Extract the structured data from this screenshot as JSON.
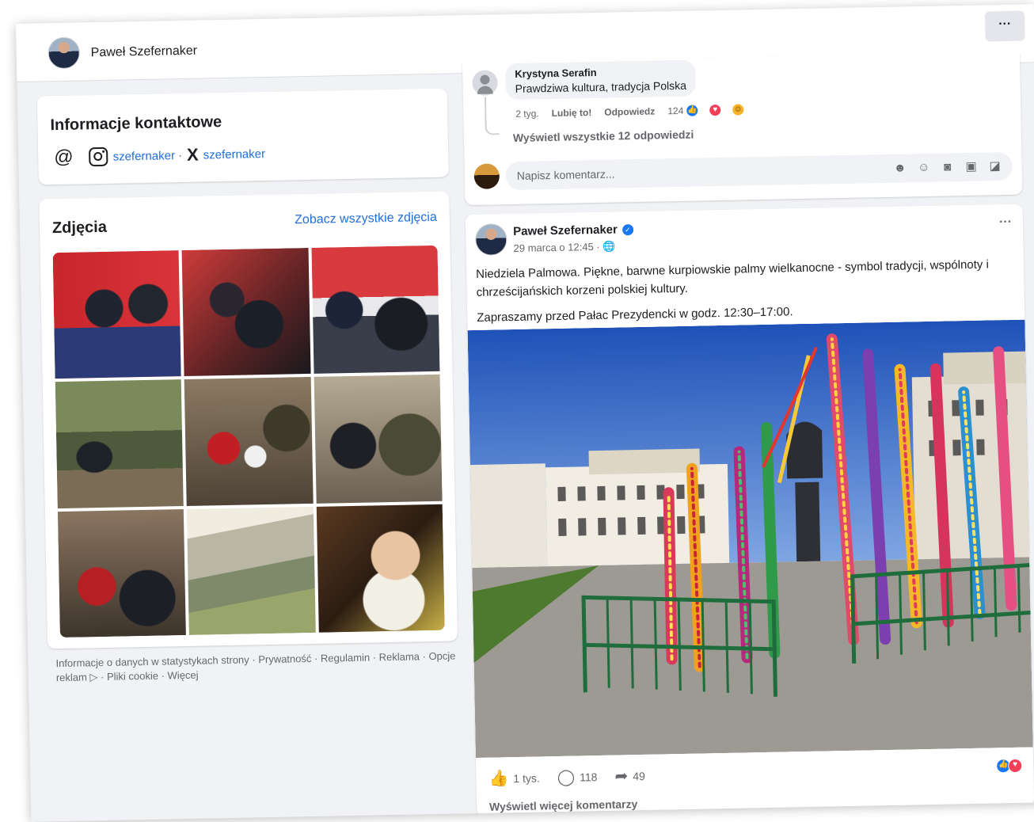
{
  "header": {
    "page_name": "Paweł Szefernaker",
    "more_label": "···"
  },
  "contact": {
    "title": "Informacje kontaktowe",
    "at_symbol": "@",
    "instagram_handle": "szefernaker",
    "separator": "·",
    "x_symbol": "X",
    "x_handle": "szefernaker"
  },
  "photos": {
    "title": "Zdjęcia",
    "see_all": "Zobacz wszystkie zdjęcia"
  },
  "footer": {
    "text": "Informacje o danych w statystykach strony · Prywatność · Regulamin · Reklama · Opcje reklam ▷ · Pliki cookie · Więcej"
  },
  "comment": {
    "author": "Krystyna Serafin",
    "text": "Prawdziwa kultura, tradycja Polska",
    "age": "2 tyg.",
    "like_label": "Lubię to!",
    "reply_label": "Odpowiedz",
    "reaction_count": "124",
    "view_replies": "Wyświetl wszystkie 12 odpowiedzi",
    "compose_placeholder": "Napisz komentarz..."
  },
  "post": {
    "author": "Paweł Szefernaker",
    "time": "29 marca o 12:45 · 🌐",
    "more_label": "···",
    "text_1": "Niedziela Palmowa. Piękne, barwne kurpiowskie palmy wielkanocne - symbol tradycji, wspólnoty i chrześcijańskich korzeni polskiej kultury.",
    "text_2": "Zapraszamy przed Pałac Prezydencki w godz. 12:30–17:00.",
    "likes": "1 tys.",
    "comments": "118",
    "shares": "49",
    "more_comments": "Wyświetl więcej komentarzy"
  },
  "icons": {
    "like": "thumbs-up-icon",
    "comment": "comment-bubble-icon",
    "share": "share-arrow-icon",
    "instagram": "instagram-icon",
    "x": "x-logo-icon",
    "email": "at-sign-icon"
  },
  "colors": {
    "link": "#216fdb",
    "like": "#1877f2",
    "love": "#f33e58",
    "background": "#f0f2f5"
  }
}
